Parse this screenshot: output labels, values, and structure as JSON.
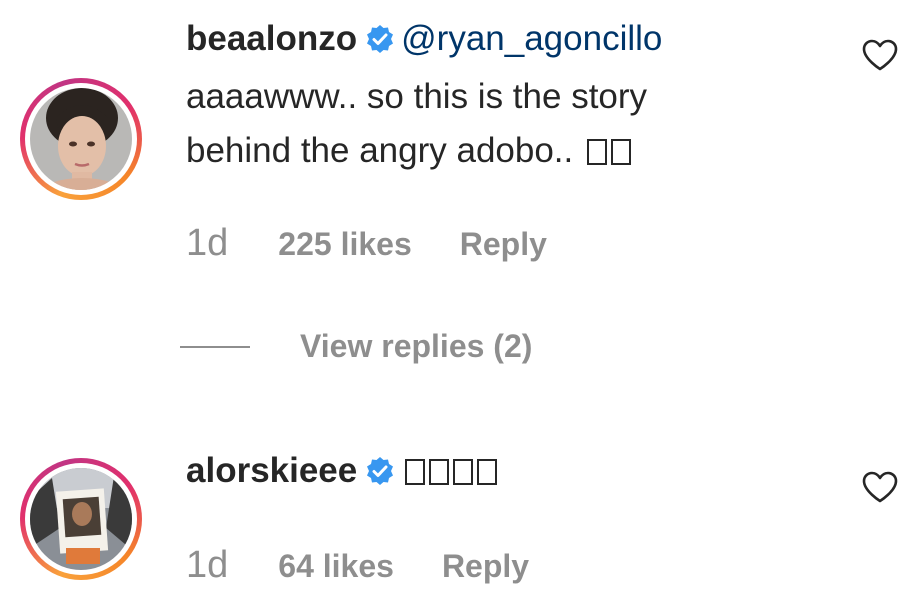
{
  "comments": [
    {
      "username": "beaalonzo",
      "verified": true,
      "mention": "@ryan_agoncillo",
      "text_line1": "aaaawww.. so this is the story",
      "text_line2": "behind the angry adobo..",
      "emoji_count": 2,
      "time": "1d",
      "likes": "225 likes",
      "reply_label": "Reply",
      "liked": false
    },
    {
      "username": "alorskieee",
      "verified": true,
      "emoji_count": 4,
      "time": "1d",
      "likes": "64 likes",
      "reply_label": "Reply",
      "liked": false
    }
  ],
  "view_replies": {
    "label": "View replies (2)"
  },
  "colors": {
    "text": "#262626",
    "muted": "#8e8e8e",
    "verified": "#3897f0",
    "mention": "#003569"
  },
  "icons": {
    "verified": "verified-badge-icon",
    "like": "heart-outline-icon"
  }
}
